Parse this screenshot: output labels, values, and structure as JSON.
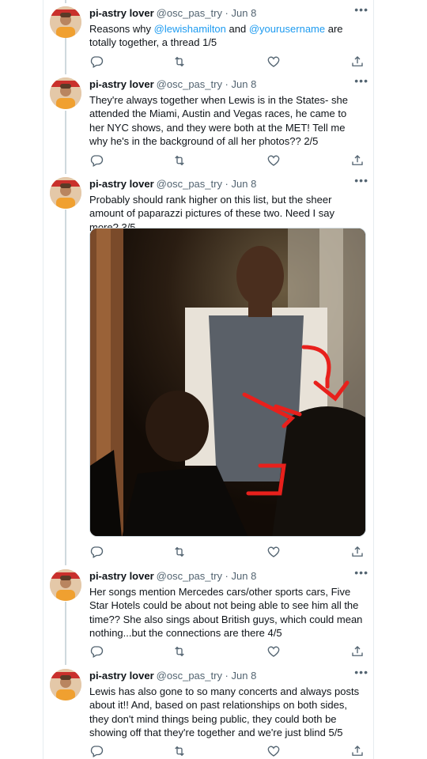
{
  "colors": {
    "link": "#1d9bf0",
    "text": "#0f1419",
    "muted": "#536471",
    "border": "#cfd9de"
  },
  "icons": {
    "reply": "reply-icon",
    "retweet": "retweet-icon",
    "like": "like-icon",
    "share": "share-icon",
    "more": "more-options-icon",
    "avatar": "avatar"
  },
  "author": {
    "name": "pi-astry lover",
    "handle_meta": "@osc_pas_try · Jun 8"
  },
  "tweets": [
    {
      "parts": [
        "Reasons why ",
        "@lewishamilton",
        " and ",
        "@yourusername",
        " are totally together, a thread 1/5"
      ]
    },
    {
      "text": "They're always together when Lewis is in the States- she attended the Miami, Austin and Vegas races, he came to her NYC shows, and they were both at the MET! Tell me why he's in the background of all her photos?? 2/5"
    },
    {
      "text": "Probably should rank higher on this list, but the sheer amount of paparazzi pictures of these two. Need I say more? 3/5",
      "has_media": true
    },
    {
      "text": "Her songs mention Mercedes cars/other sports cars, Five Star Hotels could be about not being able to see him all the time?? She also sings about British guys, which could mean nothing...but the connections are there 4/5"
    },
    {
      "text": "Lewis has also gone to so many concerts and always posts about it!! And, based on past relationships on both sides, they don't mind things being public, they could both be showing off that they're together and we're just blind 5/5"
    }
  ]
}
